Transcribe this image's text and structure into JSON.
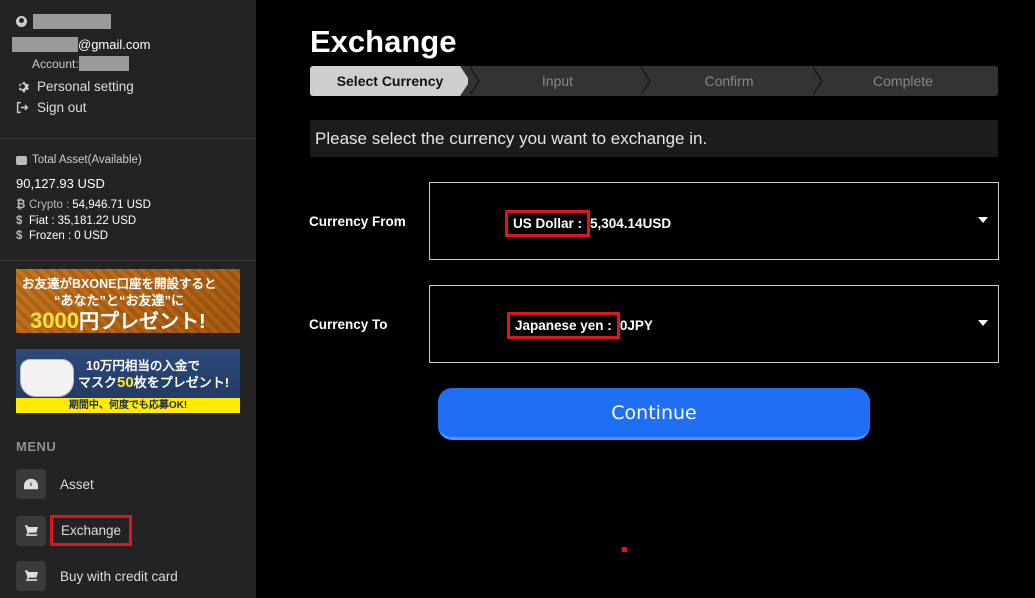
{
  "sidebar": {
    "email_suffix": "@gmail.com",
    "account_label": "Account:",
    "personal_setting": "Personal setting",
    "sign_out": "Sign out",
    "asset_label": "Total Asset(Available)",
    "asset_total": "90,127.93 USD",
    "crypto_label": "Crypto :",
    "crypto_value": "54,946.71 USD",
    "fiat_label": "Fiat :",
    "fiat_value": "35,181.22 USD",
    "frozen_label": "Frozen :",
    "frozen_value": "0 USD",
    "banner1": {
      "line1": "お友達がBXONE口座を開設すると",
      "line2": "“あなた”と“お友達”に",
      "line3_amount": "3000",
      "line3_unit": "円",
      "line3_rest": "プレゼント!"
    },
    "banner2": {
      "line1": "10万円相当の入金で",
      "line2_a": "マスク",
      "line2_b": "50",
      "line2_c": "枚をプレゼント!",
      "line3": "期間中、何度でも応募OK!"
    },
    "menu_title": "MENU",
    "menu_items": [
      {
        "label": "Asset",
        "icon": "dashboard-icon"
      },
      {
        "label": "Exchange",
        "icon": "cart-icon"
      },
      {
        "label": "Buy with credit card",
        "icon": "cart-icon"
      }
    ]
  },
  "main": {
    "title": "Exchange",
    "steps": [
      "Select Currency",
      "Input",
      "Confirm",
      "Complete"
    ],
    "notice": "Please select the currency you want to exchange in.",
    "currency_from": {
      "label": "Currency From",
      "name": "US Dollar :",
      "amount": "5,304.14USD"
    },
    "currency_to": {
      "label": "Currency To",
      "name": "Japanese yen :",
      "amount": "0JPY"
    },
    "continue_label": "Continue"
  },
  "colors": {
    "accent": "#1f6ff5",
    "highlight": "#e0141f",
    "sidebar_bg": "#232323"
  }
}
